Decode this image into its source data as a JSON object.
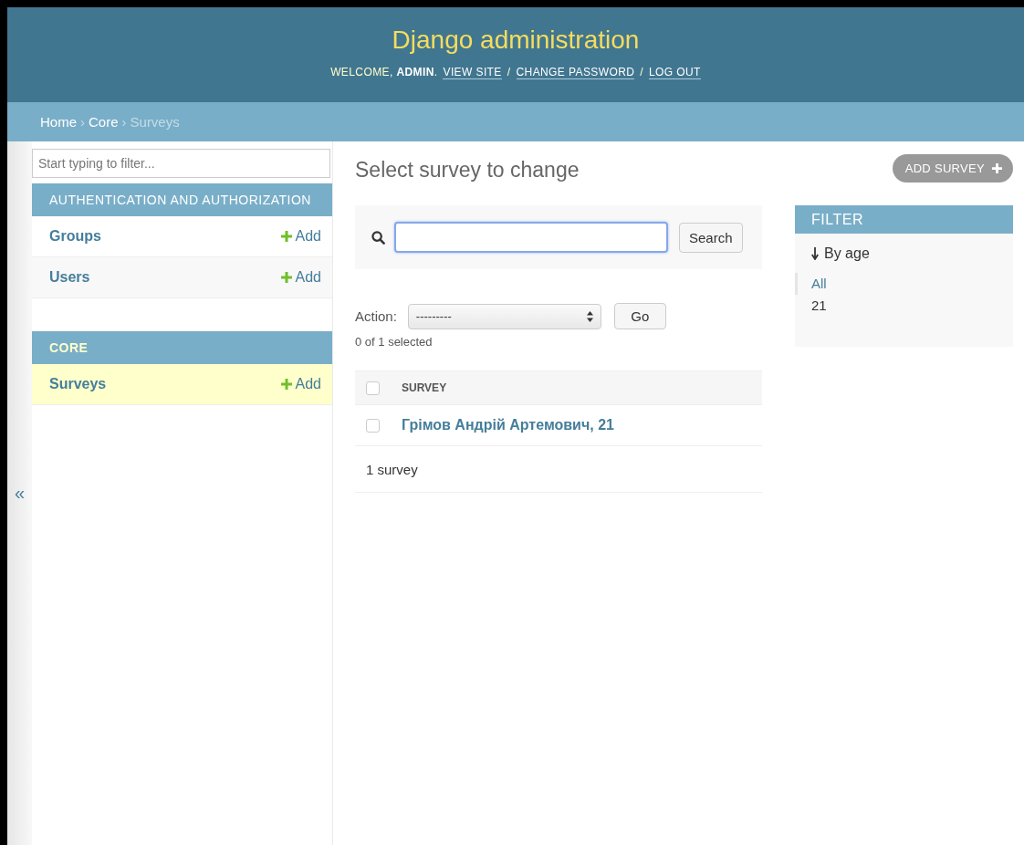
{
  "header": {
    "title": "Django administration",
    "welcome": "WELCOME, **ADMIN**.",
    "links": [
      "VIEW SITE",
      "CHANGE PASSWORD",
      "LOG OUT"
    ],
    "separator": "/"
  },
  "breadcrumbs": {
    "separator": "›",
    "items": [
      {
        "label": "Home",
        "current": false
      },
      {
        "label": "Core",
        "current": false
      },
      {
        "label": "Surveys",
        "current": true
      }
    ]
  },
  "sidebar": {
    "toggle": "«",
    "filter": {
      "placeholder": "Start typing to filter..."
    },
    "apps": [
      {
        "name": "AUTHENTICATION AND AUTHORIZATION",
        "models": [
          {
            "name": "Groups",
            "add": "Add",
            "selected": false
          },
          {
            "name": "Users",
            "add": "Add",
            "selected": false
          }
        ]
      },
      {
        "name": "CORE",
        "models": [
          {
            "name": "Surveys",
            "add": "Add",
            "selected": true
          }
        ]
      }
    ]
  },
  "main": {
    "title": "Select survey to change",
    "add_button": "ADD SURVEY",
    "search": {
      "button": "Search"
    },
    "action": {
      "label": "Action:",
      "value": "---------",
      "go": "Go",
      "counter": "0 of 1 selected"
    },
    "table": {
      "columns": [
        {
          "label": "SURVEY"
        }
      ],
      "header_checked": false,
      "rows": [
        {
          "cells": [
            "Грімов Андрій Артемович, 21"
          ],
          "checked": false
        }
      ]
    },
    "result_count": "1 survey"
  },
  "filter": {
    "title": "FILTER",
    "groups": [
      {
        "title": "By age",
        "choices": [
          {
            "label": "All",
            "selected": true
          },
          {
            "label": "21",
            "selected": false
          }
        ]
      }
    ]
  }
}
